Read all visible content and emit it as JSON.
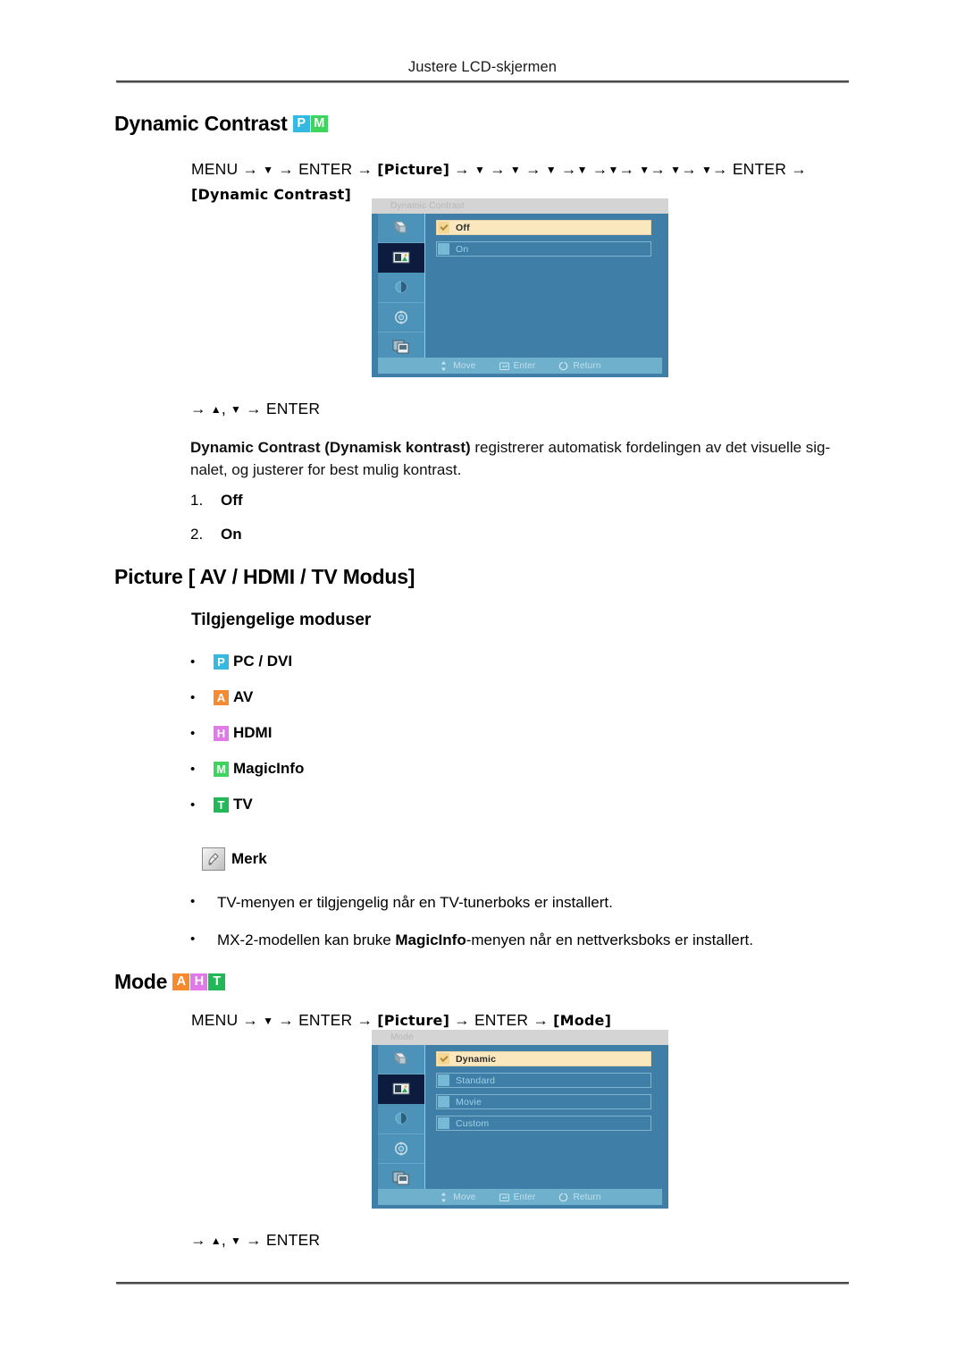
{
  "page": {
    "running_header": "Justere LCD-skjermen"
  },
  "sections": {
    "dynamic_contrast": {
      "heading": "Dynamic Contrast",
      "badges": [
        {
          "letter": "P",
          "color": "#35b9e0"
        },
        {
          "letter": "M",
          "color": "#3fd35f"
        }
      ],
      "path": {
        "menu": "MENU",
        "enter": "ENTER",
        "picture": "[Picture]",
        "target": "[Dynamic Contrast]",
        "down_arrow": "▼",
        "arrow": "→"
      },
      "nav_hint": {
        "arrow": "→",
        "up": "▲",
        "comma": ",",
        "down": "▼",
        "enter": "ENTER"
      },
      "description": "Dynamic Contrast (Dynamisk kontrast) registrerer automatisk fordelingen av det visuelle signalet, og justerer for best mulig kontrast.",
      "description_bold": "Dynamic Contrast (Dynamisk kontrast)",
      "description_rest": " registrerer automatisk fordelingen av det visuelle sig-",
      "description_line2": "nalet, og justerer for best mulig kontrast.",
      "options": [
        {
          "num": "1.",
          "label": "Off"
        },
        {
          "num": "2.",
          "label": "On"
        }
      ],
      "osd": {
        "title": "Dynamic Contrast",
        "rows": [
          {
            "label": "Off",
            "selected": true
          },
          {
            "label": "On",
            "selected": false
          }
        ],
        "footer": [
          {
            "icon": "updown-arrows-icon",
            "label": "Move"
          },
          {
            "icon": "enter-key-icon",
            "label": "Enter"
          },
          {
            "icon": "return-circle-icon",
            "label": "Return"
          }
        ],
        "sidebar_icons": [
          {
            "name": "input-source-icon",
            "selected": false
          },
          {
            "name": "picture-icon",
            "selected": true
          },
          {
            "name": "sound-icon",
            "selected": false
          },
          {
            "name": "setup-icon",
            "selected": false
          },
          {
            "name": "multi-control-icon",
            "selected": false
          }
        ]
      }
    },
    "picture_modes": {
      "heading": "Picture [ AV / HDMI / TV Modus]",
      "subheading": "Tilgjengelige moduser",
      "items": [
        {
          "badge": "P",
          "color": "#35b9e0",
          "label": "PC / DVI"
        },
        {
          "badge": "A",
          "color": "#f58a2e",
          "label": "AV"
        },
        {
          "badge": "H",
          "color": "#e07ae8",
          "label": "HDMI"
        },
        {
          "badge": "M",
          "color": "#3fd35f",
          "label": "MagicInfo"
        },
        {
          "badge": "T",
          "color": "#22b757",
          "label": "TV"
        }
      ],
      "note": {
        "icon": "note-pencil-icon",
        "title": "Merk",
        "items": [
          {
            "text": "TV-menyen er tilgjengelig når en TV-tunerboks er installert."
          },
          {
            "prefix": "MX-2-modellen kan bruke ",
            "bold": "MagicInfo",
            "suffix": "-menyen når en nettverksboks er installert."
          }
        ]
      }
    },
    "mode": {
      "heading": "Mode",
      "badges": [
        {
          "letter": "A",
          "color": "#f58a2e"
        },
        {
          "letter": "H",
          "color": "#e07ae8"
        },
        {
          "letter": "T",
          "color": "#22b757"
        }
      ],
      "path": {
        "menu": "MENU",
        "enter": "ENTER",
        "picture": "[Picture]",
        "target": "[Mode]",
        "down_arrow": "▼",
        "arrow": "→"
      },
      "nav_hint": {
        "arrow": "→",
        "up": "▲",
        "comma": ",",
        "down": "▼",
        "enter": "ENTER"
      },
      "osd": {
        "title": "Mode",
        "rows": [
          {
            "label": "Dynamic",
            "selected": true
          },
          {
            "label": "Standard",
            "selected": false
          },
          {
            "label": "Movie",
            "selected": false
          },
          {
            "label": "Custom",
            "selected": false
          }
        ],
        "footer": [
          {
            "icon": "updown-arrows-icon",
            "label": "Move"
          },
          {
            "icon": "enter-key-icon",
            "label": "Enter"
          },
          {
            "icon": "return-circle-icon",
            "label": "Return"
          }
        ],
        "sidebar_icons": [
          {
            "name": "input-source-icon",
            "selected": false
          },
          {
            "name": "picture-icon",
            "selected": true
          },
          {
            "name": "sound-icon",
            "selected": false
          },
          {
            "name": "setup-icon",
            "selected": false
          },
          {
            "name": "multi-control-icon",
            "selected": false
          }
        ]
      }
    }
  }
}
